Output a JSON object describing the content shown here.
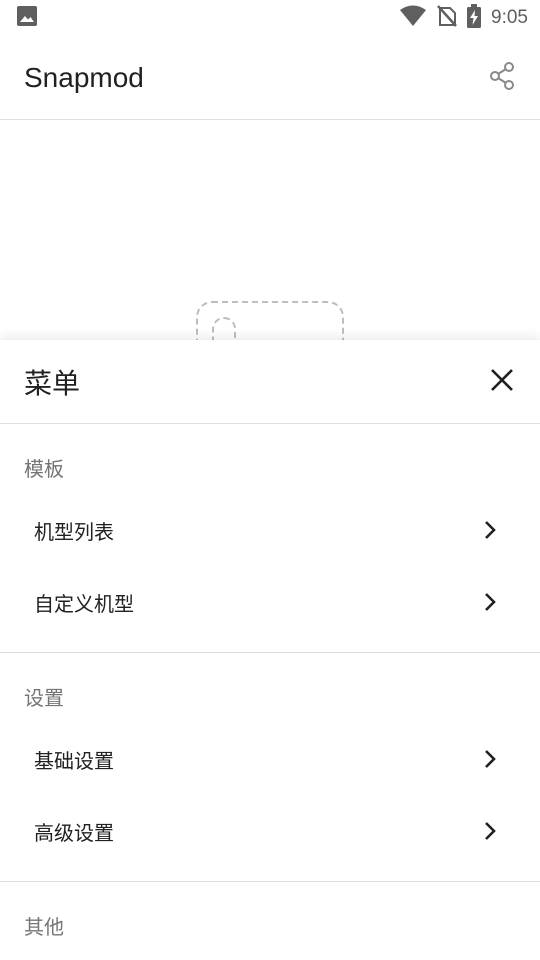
{
  "status_bar": {
    "time": "9:05",
    "icons": [
      "image-icon",
      "wifi-icon",
      "no-sim-icon",
      "battery-charging-icon"
    ]
  },
  "app_bar": {
    "title": "Snapmod",
    "share_icon": "share-icon"
  },
  "sheet": {
    "title": "菜单",
    "close_icon": "close-icon",
    "sections": [
      {
        "title": "模板",
        "items": [
          {
            "label": "机型列表"
          },
          {
            "label": "自定义机型"
          }
        ]
      },
      {
        "title": "设置",
        "items": [
          {
            "label": "基础设置"
          },
          {
            "label": "高级设置"
          }
        ]
      },
      {
        "title": "其他",
        "items": []
      }
    ]
  },
  "colors": {
    "text_primary": "#212121",
    "text_secondary": "#757575",
    "divider": "#e0e0e0",
    "status_icon": "#5f5f5f"
  }
}
